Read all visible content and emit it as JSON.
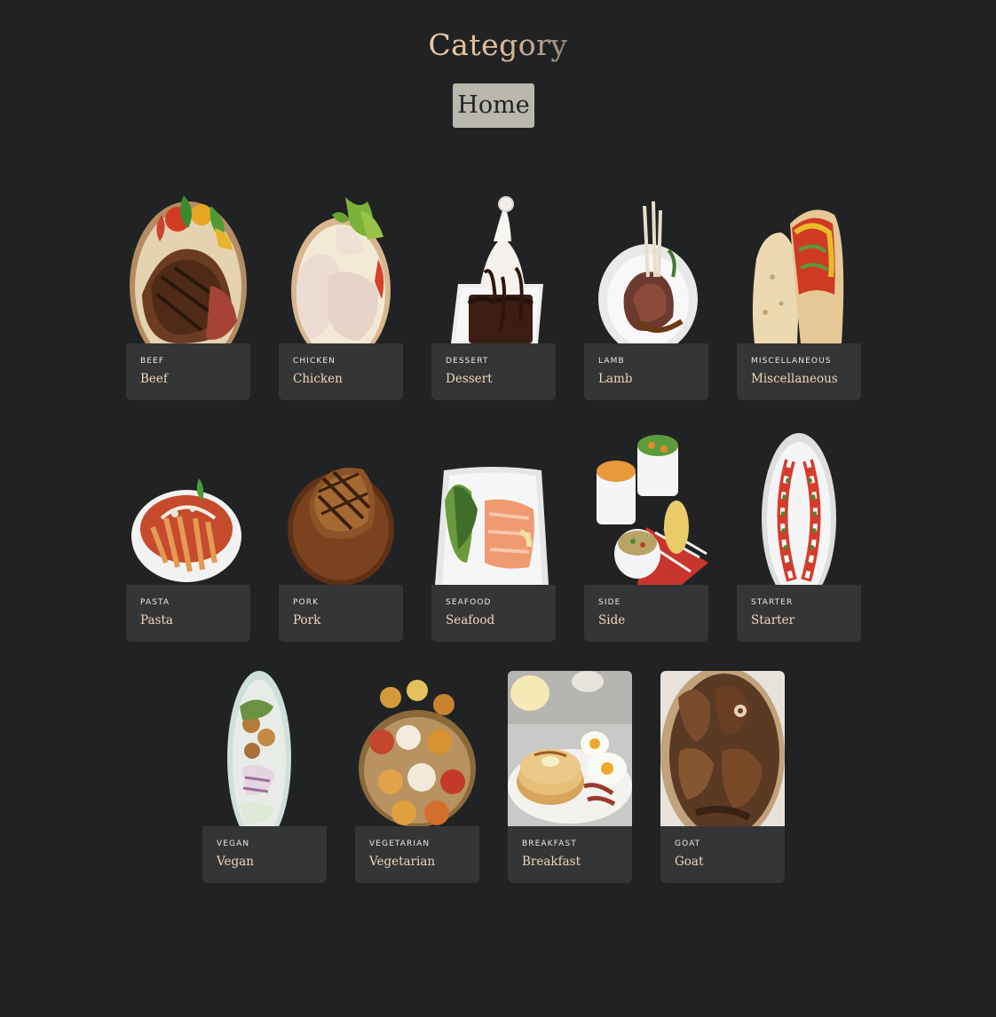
{
  "page": {
    "title": "Category",
    "home_label": "Home"
  },
  "categories": [
    {
      "kicker": "BEEF",
      "name": "Beef",
      "image": "grilled-steak-with-vegetables"
    },
    {
      "kicker": "CHICKEN",
      "name": "Chicken",
      "image": "raw-chicken-legs-with-greens"
    },
    {
      "kicker": "DESSERT",
      "name": "Dessert",
      "image": "chocolate-brownie-with-cream"
    },
    {
      "kicker": "LAMB",
      "name": "Lamb",
      "image": "lamb-rack-on-plate"
    },
    {
      "kicker": "MISCELLANEOUS",
      "name": "Miscellaneous",
      "image": "tacos"
    },
    {
      "kicker": "PASTA",
      "name": "Pasta",
      "image": "penne-in-tomato-sauce"
    },
    {
      "kicker": "PORK",
      "name": "Pork",
      "image": "grilled-pork-chop-on-board"
    },
    {
      "kicker": "SEAFOOD",
      "name": "Seafood",
      "image": "smoked-salmon-with-salad"
    },
    {
      "kicker": "SIDE",
      "name": "Side",
      "image": "side-dishes-in-ramekins"
    },
    {
      "kicker": "STARTER",
      "name": "Starter",
      "image": "caprese-salad-plate"
    },
    {
      "kicker": "VEGAN",
      "name": "Vegan",
      "image": "vegan-bowl"
    },
    {
      "kicker": "VEGETARIAN",
      "name": "Vegetarian",
      "image": "vegetarian-thali"
    },
    {
      "kicker": "BREAKFAST",
      "name": "Breakfast",
      "image": "pancakes-eggs-bacon"
    },
    {
      "kicker": "GOAT",
      "name": "Goat",
      "image": "goat-meat-curry"
    }
  ]
}
